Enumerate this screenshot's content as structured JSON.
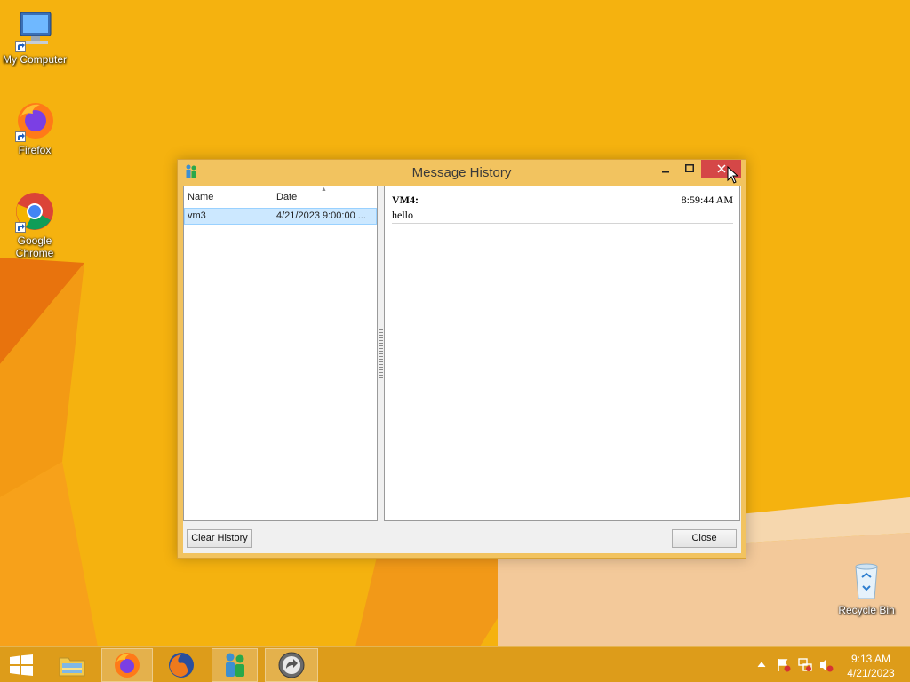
{
  "desktop": {
    "icons": [
      {
        "label": "My Computer"
      },
      {
        "label": "Firefox"
      },
      {
        "label": "Google Chrome"
      },
      {
        "label": "Recycle Bin"
      }
    ]
  },
  "window": {
    "title": "Message History",
    "controls": {
      "minimize": "–",
      "maximize": "☐",
      "close": "×"
    },
    "list": {
      "columns": [
        "Name",
        "Date"
      ],
      "rows": [
        {
          "name": "vm3",
          "date": "4/21/2023 9:00:00 ..."
        }
      ]
    },
    "message": {
      "sender": "VM4:",
      "time": "8:59:44 AM",
      "text": "hello"
    },
    "buttons": {
      "clear_history": "Clear History",
      "close": "Close"
    }
  },
  "taskbar": {
    "clock": {
      "time": "9:13 AM",
      "date": "4/21/2023"
    },
    "items": [
      "start",
      "file-explorer",
      "firefox",
      "firefox-legacy",
      "messenger",
      "app-circle"
    ]
  },
  "colors": {
    "wallpaper": "#f4b10f",
    "window_frame": "#f2c35f",
    "close_button": "#d54747",
    "selection": "#cce8ff"
  }
}
